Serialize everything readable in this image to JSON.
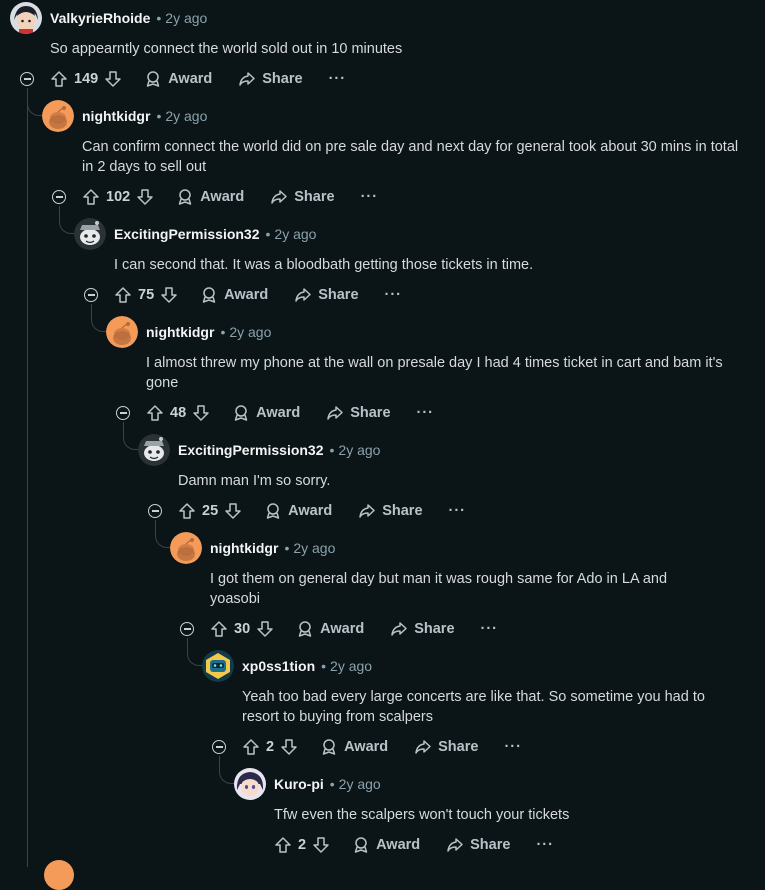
{
  "comments": [
    {
      "user": "ValkyrieRhoide",
      "time": "2y ago",
      "text": "So appearntly connect the world sold out in 10 minutes",
      "score": "149",
      "avatar": "anime-character-avatar"
    },
    {
      "user": "nightkidgr",
      "time": "2y ago",
      "text": "Can confirm connect the world did on pre sale day and next day for general took about 30 mins in total in 2 days to sell out",
      "score": "102",
      "avatar": "snoo-orange-avatar"
    },
    {
      "user": "ExcitingPermission32",
      "time": "2y ago",
      "text": "I can second that. It was a bloodbath getting those tickets in time.",
      "score": "75",
      "avatar": "snoo-gray-avatar"
    },
    {
      "user": "nightkidgr",
      "time": "2y ago",
      "text": "I almost threw my phone at the wall on presale day I had 4 times ticket in cart and bam it's gone",
      "score": "48",
      "avatar": "snoo-orange-avatar"
    },
    {
      "user": "ExcitingPermission32",
      "time": "2y ago",
      "text": "Damn man I'm so sorry.",
      "score": "25",
      "avatar": "snoo-gray-avatar"
    },
    {
      "user": "nightkidgr",
      "time": "2y ago",
      "text": "I got them on general day but man it was rough same for Ado in LA and yoasobi",
      "score": "30",
      "avatar": "snoo-orange-avatar"
    },
    {
      "user": "xp0ss1tion",
      "time": "2y ago",
      "text": "Yeah too bad every large concerts are like that. So sometime you had to resort to buying from scalpers",
      "score": "2",
      "avatar": "robot-avatar"
    },
    {
      "user": "Kuro-pi",
      "time": "2y ago",
      "text": "Tfw even the scalpers won't touch your tickets",
      "score": "2",
      "avatar": "anime-girl-avatar"
    }
  ],
  "labels": {
    "award": "Award",
    "share": "Share",
    "more": "···",
    "dot": "•"
  },
  "colors": {
    "background": "#0b1416",
    "thread_line": "#3a4448",
    "snoo_orange": "#f59b5a",
    "meta": "#8ba2ad"
  }
}
